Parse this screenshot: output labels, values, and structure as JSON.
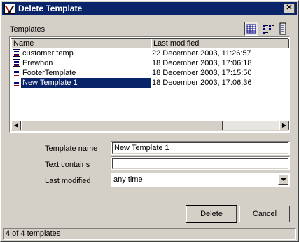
{
  "window": {
    "title": "Delete Template"
  },
  "list": {
    "label": "Templates",
    "columns": [
      "Name",
      "Last modified"
    ],
    "rows": [
      {
        "name": "customer temp",
        "modified": "22 December 2003, 11:26:57",
        "selected": false
      },
      {
        "name": "Erewhon",
        "modified": "18 December 2003, 17:06:18",
        "selected": false
      },
      {
        "name": "FooterTemplate",
        "modified": "18 December 2003, 17:15:50",
        "selected": false
      },
      {
        "name": "New Template 1",
        "modified": "18 December 2003, 17:06:36",
        "selected": true
      }
    ],
    "view_icons": [
      "details-view-icon",
      "list-view-icon",
      "large-icon-view-icon"
    ],
    "selection_color": "#0a246a"
  },
  "form": {
    "template_name_label_hot": "Template ",
    "template_name_label_rest": "name",
    "template_name_value": "New Template 1",
    "text_contains_label_hot": "T",
    "text_contains_label_rest": "ext contains",
    "text_contains_value": "",
    "last_modified_label_pre": "Last ",
    "last_modified_label_hot": "m",
    "last_modified_label_rest": "odified",
    "last_modified_value": "any time"
  },
  "buttons": {
    "delete": "Delete",
    "cancel": "Cancel"
  },
  "status": {
    "text": "4 of 4 templates"
  }
}
